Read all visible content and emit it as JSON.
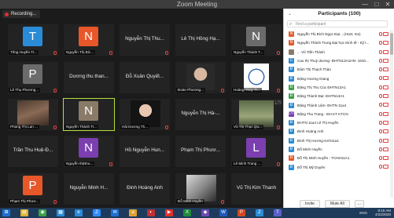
{
  "window": {
    "title": "Zoom Meeting",
    "min": "—",
    "max": "□",
    "close": "✕"
  },
  "recording": {
    "label": "Recording..."
  },
  "tiles": [
    {
      "name": "Tống Huyền Tr...",
      "initial": "T",
      "color": "#2a8bd6",
      "kind": "avatar",
      "muted": true
    },
    {
      "name": "Nguyễn Thị Bíc...",
      "initial": "N",
      "color": "#e8572a",
      "kind": "avatar",
      "muted": true
    },
    {
      "name": "Nguyễn Thị Thu...",
      "kind": "text",
      "muted": true
    },
    {
      "name": "Lê Thị Hồng Hạ...",
      "kind": "text",
      "muted": false
    },
    {
      "name": "Nguyễn Thành T...",
      "initial": "N",
      "color": "#6b6b6b",
      "kind": "avatar",
      "muted": true
    },
    {
      "name": "Lê Thụ Phương...",
      "initial": "P",
      "color": "#6b6b6b",
      "kind": "avatar",
      "muted": true
    },
    {
      "name": "Dương thu than...",
      "kind": "text",
      "muted": false
    },
    {
      "name": "Đỗ Xuân Quyết...",
      "kind": "text",
      "muted": false
    },
    {
      "name": "Đoàn Phương...",
      "kind": "photo",
      "photo": "b",
      "muted": true
    },
    {
      "name": "Hoàng Thúy Tr...",
      "kind": "photo",
      "photo": "d",
      "muted": true
    },
    {
      "name": "Phùng Thị Lan ...",
      "kind": "photo",
      "photo": "a",
      "muted": true
    },
    {
      "name": "Nguyễn Thành Tr...",
      "initial": "N",
      "color": "#8a7a68",
      "kind": "avatar",
      "muted": false,
      "highlight": true
    },
    {
      "name": "Hải Dương Th...",
      "kind": "photo",
      "photo": "f",
      "muted": true
    },
    {
      "name": "Nguyễn Thị Hà-...",
      "kind": "text",
      "muted": false
    },
    {
      "name": "Vũ Thị Thục Qu...",
      "kind": "photo",
      "photo": "e",
      "muted": true
    },
    {
      "name": "Trần Thu Huệ-Đ...",
      "kind": "text",
      "muted": false
    },
    {
      "name": "Nguyễn thịNhu...",
      "initial": "N",
      "color": "#7b3fb0",
      "kind": "avatar",
      "muted": true
    },
    {
      "name": "Hồ Nguyễn Hun...",
      "kind": "text",
      "muted": false
    },
    {
      "name": "Phạm Thị Phươ...",
      "kind": "text",
      "muted": false
    },
    {
      "name": "Lê Minh Trang ...",
      "initial": "L",
      "color": "#7b3fb0",
      "kind": "avatar",
      "muted": true
    },
    {
      "name": "Phạm Thị Phươ...",
      "initial": "P",
      "color": "#e8572a",
      "kind": "avatar",
      "muted": true
    },
    {
      "name": "Nguyễn Minh H...",
      "kind": "text",
      "muted": false
    },
    {
      "name": "Đinh Hoàng Anh",
      "kind": "text",
      "muted": false
    },
    {
      "name": "Đỗ Minh Huyền",
      "kind": "photo",
      "photo": "g",
      "muted": true
    },
    {
      "name": "Vũ Thị Kim Thanh",
      "kind": "text",
      "muted": false
    }
  ],
  "pager": "1/5",
  "panel": {
    "title": "Participants (100)",
    "collapse_icon": "⌄",
    "search_placeholder": "Find a participant",
    "participants": [
      {
        "initial": "N",
        "color": "#e8572a",
        "name": "Nguyễn Thị Bích Ngọc Đại... (Host, me)"
      },
      {
        "initial": "N",
        "color": "#e8572a",
        "name": "Nguyễn Thành Trung Đại học Kinh tế - Kỹ t..."
      },
      {
        "initial": "",
        "color": "#8a7a68",
        "name": "... Vũ Tiến Thành"
      },
      {
        "initial": "C",
        "color": "#2a8bd6",
        "name": "Cao thị Thuỳ dương- ĐHTN13A1HN- 1910..."
      },
      {
        "initial": "Đ",
        "color": "#2a8bd6",
        "name": "Đàm Thị Thạch Thảo"
      },
      {
        "initial": "Đ",
        "color": "#2a8bd6",
        "name": "Đặng Hương Giang"
      },
      {
        "initial": "Đ",
        "color": "#3aa048",
        "name": "Đặng Thị Thu Cúc ĐHTN13A1"
      },
      {
        "initial": "Đ",
        "color": "#3aa048",
        "name": "Đặng Thành Đạt -ĐHTN13A1"
      },
      {
        "initial": "Đ",
        "color": "#2a8bd6",
        "name": "Đặng Thành Lâm- ĐHTN 11a4"
      },
      {
        "initial": "DT",
        "color": "#7b3fb0",
        "name": "Đặng Thu Trang - ĐH KT KTCN"
      },
      {
        "initial": "Đ",
        "color": "#2a8bd6",
        "name": "ĐHTN 11a4 Lê Thị Huyền"
      },
      {
        "initial": "Đ",
        "color": "#2a8bd6",
        "name": "Đinh Hoàng Anh"
      },
      {
        "initial": "Đ",
        "color": "#2a8bd6",
        "name": "Đinh Thị Hương-tcnh11a1"
      },
      {
        "initial": "Đ",
        "color": "#2a8bd6",
        "name": "Đỗ Minh Huyền"
      },
      {
        "initial": "Đ",
        "color": "#e8572a",
        "name": "Đỗ Thị Minh Huyền - TCNH11A1"
      },
      {
        "initial": "Đ",
        "color": "#2a8bd6",
        "name": "Đỗ Thị Mỹ Duyên"
      }
    ],
    "footer": {
      "invite": "Invite",
      "mute_all": "Mute All",
      "more": "..."
    }
  },
  "taskbar": {
    "icons": [
      "start-icon",
      "file-explorer-icon",
      "chrome-icon",
      "store-icon",
      "edge-icon",
      "zoom-icon",
      "mail-icon",
      "amazon-icon",
      "photos-icon",
      "video-icon",
      "excel-icon",
      "app-icon",
      "word-icon",
      "powerpoint-icon",
      "zalo-icon",
      "teams-icon"
    ],
    "colors": [
      "#1f6fd0",
      "#e0b030",
      "#3aa048",
      "#2a8bd6",
      "#2a8bd6",
      "#2d8cff",
      "#1f6fd0",
      "#e0a030",
      "#c03030",
      "#e0302a",
      "#1f8a3a",
      "#6b4ab0",
      "#1f5ab8",
      "#d04a20",
      "#2a8bd6",
      "#5b5fc7"
    ],
    "glyphs": [
      "⊞",
      "▤",
      "◉",
      "▦",
      "e",
      "Z",
      "✉",
      "a",
      "◐",
      "▶",
      "X",
      "◆",
      "W",
      "P",
      "Z",
      "T"
    ],
    "lang": "ENG",
    "time": "8:15 AM",
    "date": "4/22/2020"
  }
}
